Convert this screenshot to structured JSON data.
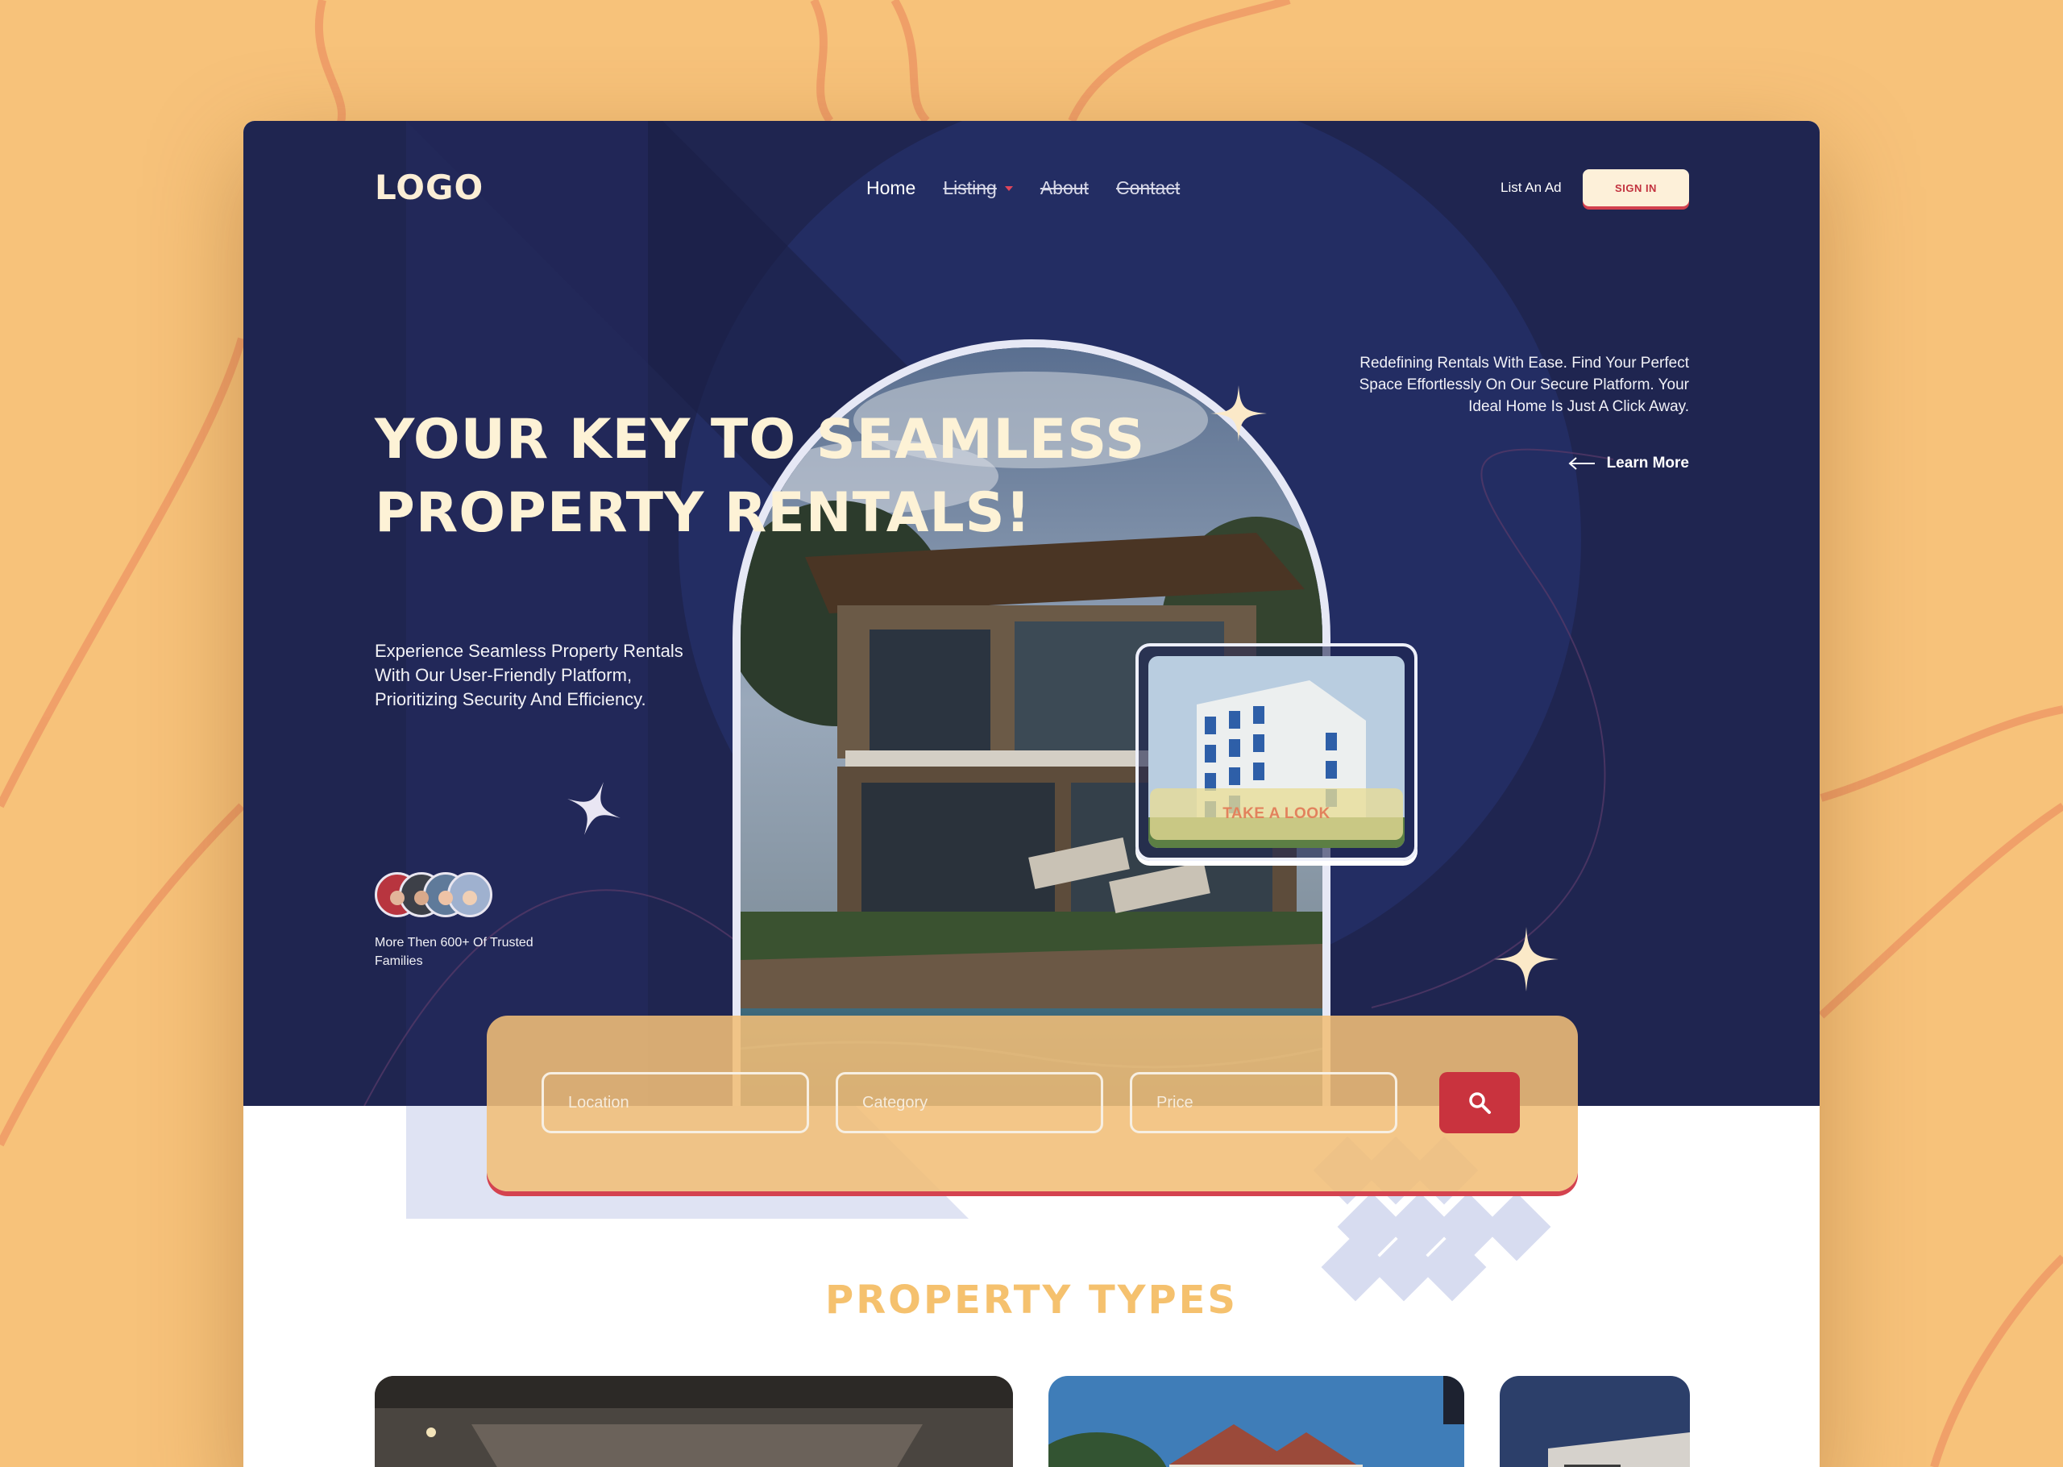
{
  "nav": {
    "logo": "LOGO",
    "links": [
      "Home",
      "Listing",
      "About",
      "Contact"
    ],
    "list_ad": "List An Ad",
    "sign_in": "SIGN IN"
  },
  "hero": {
    "headline": "YOUR KEY TO SEAMLESS PROPERTY RENTALS!",
    "subtext": "Experience Seamless Property Rentals With Our User-Friendly Platform, Prioritizing Security And Efficiency.",
    "description": "Redefining Rentals With Ease. Find Your Perfect Space Effortlessly On Our Secure Platform. Your Ideal Home Is Just A Click Away.",
    "learn_more": "Learn More",
    "take_a_look": "TAKE A LOOK",
    "trusted": "More Then 600+ Of Trusted Families"
  },
  "search": {
    "location_placeholder": "Location",
    "category_placeholder": "Category",
    "price_placeholder": "Price"
  },
  "sections": {
    "property_types_title": "PROPERTY TYPES"
  },
  "colors": {
    "hero_bg": "#1f2550",
    "accent_cream": "#fdf2d6",
    "accent_red": "#c9333e",
    "accent_orange": "#f5c16e",
    "page_bg": "#f7c27a"
  },
  "icons": [
    "search-icon",
    "arrow-left-icon",
    "sparkle-icon",
    "chevron-down-icon"
  ]
}
